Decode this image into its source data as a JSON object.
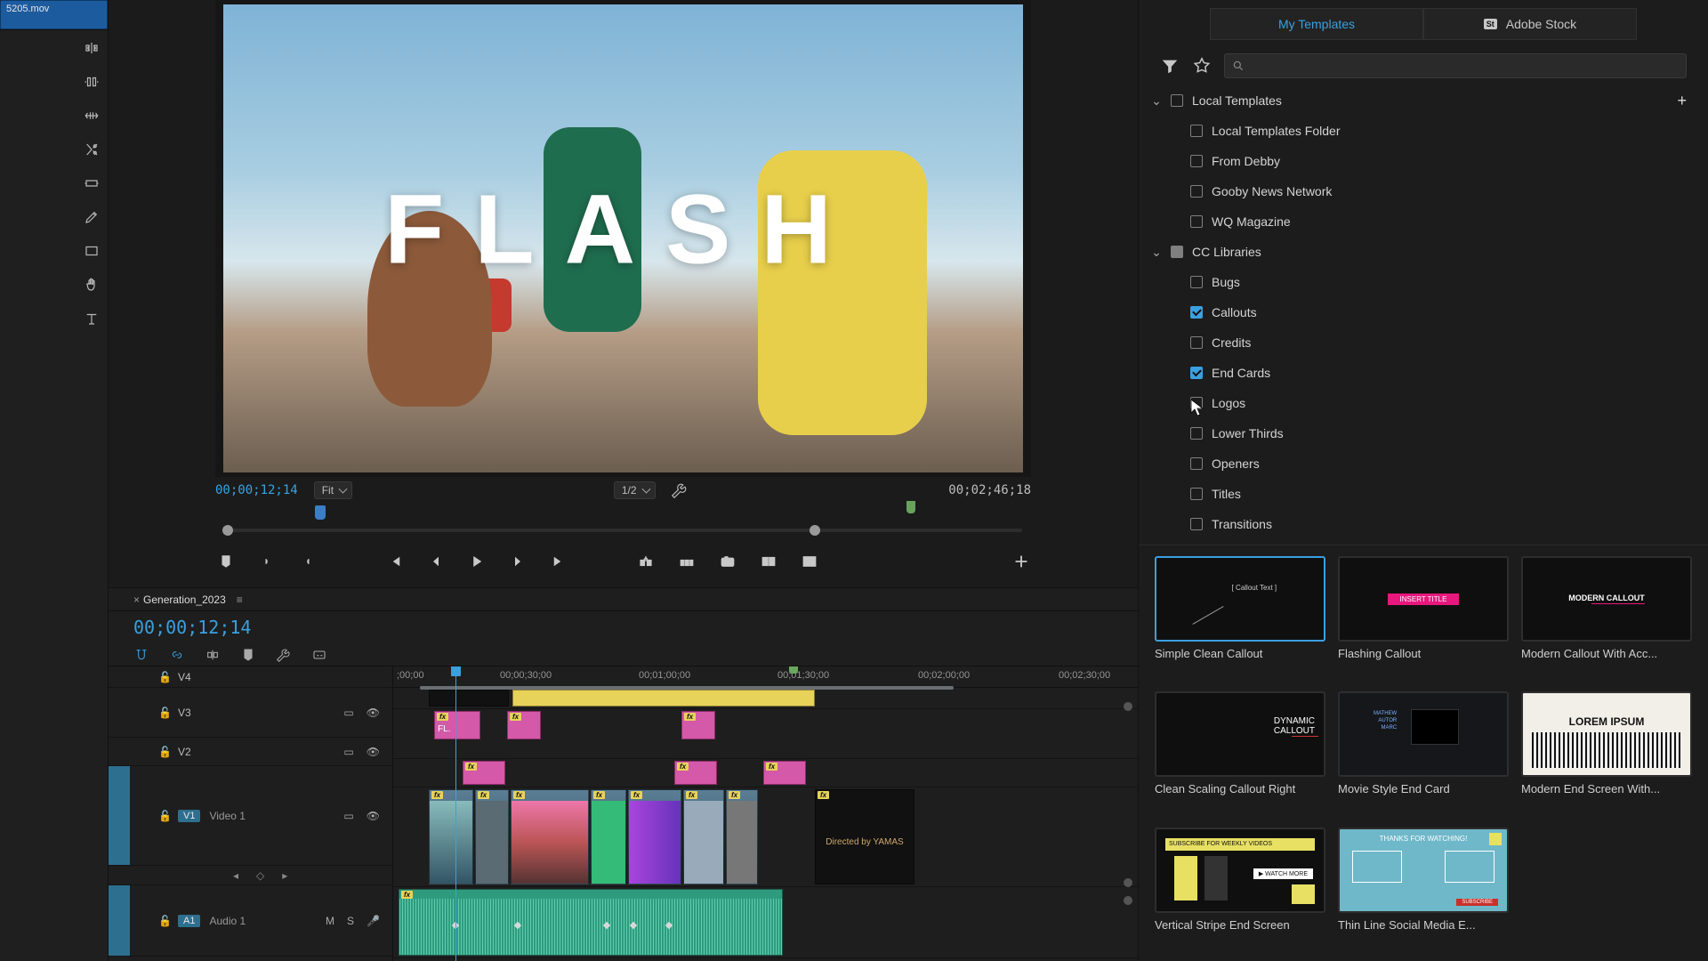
{
  "bin": {
    "clip_name": "5205.mov"
  },
  "monitor": {
    "title_overlay": "FLASH",
    "tc_in": "00;00;12;14",
    "zoom": "Fit",
    "res": "1/2",
    "tc_out": "00;02;46;18"
  },
  "timeline": {
    "sequence_name": "Generation_2023",
    "tc": "00;00;12;14",
    "ruler": [
      ";00;00",
      "00;00;30;00",
      "00;01;00;00",
      "00;01;30;00",
      "00;02;00;00",
      "00;02;30;00"
    ],
    "tracks": {
      "v4": "V4",
      "v3": "V3",
      "v2": "V2",
      "v1": "V1",
      "a1": "A1",
      "video1_label": "Video 1",
      "audio1_label": "Audio 1"
    },
    "audio_toggles": {
      "m": "M",
      "s": "S"
    },
    "v3_clip1": "FL."
  },
  "eg": {
    "tab_my": "My Templates",
    "tab_stock": "Adobe Stock",
    "search_placeholder": "",
    "tree": {
      "local": "Local Templates",
      "local_items": [
        "Local Templates Folder",
        "From Debby",
        "Gooby News Network",
        "WQ Magazine"
      ],
      "cc": "CC Libraries",
      "cc_items": [
        {
          "label": "Bugs",
          "checked": false
        },
        {
          "label": "Callouts",
          "checked": true
        },
        {
          "label": "Credits",
          "checked": false
        },
        {
          "label": "End Cards",
          "checked": true
        },
        {
          "label": "Logos",
          "checked": false
        },
        {
          "label": "Lower Thirds",
          "checked": false
        },
        {
          "label": "Openers",
          "checked": false
        },
        {
          "label": "Titles",
          "checked": false
        },
        {
          "label": "Transitions",
          "checked": false
        }
      ]
    },
    "templates": [
      {
        "name": "Simple Clean Callout"
      },
      {
        "name": "Flashing Callout"
      },
      {
        "name": "Modern Callout With Acc..."
      },
      {
        "name": "Clean Scaling Callout Right"
      },
      {
        "name": "Movie Style End Card"
      },
      {
        "name": "Modern End Screen With..."
      },
      {
        "name": "Vertical Stripe End Screen"
      },
      {
        "name": "Thin Line Social Media E..."
      }
    ],
    "prev_text": {
      "t0": "[ Callout Text ]",
      "t1": "INSERT TITLE",
      "t2": "MODERN CALLOUT",
      "t3": "DYNAMIC\nCALLOUT",
      "t5": "LOREM IPSUM",
      "t6a": "SUBSCRIBE FOR WEEKLY VIDEOS",
      "t6b": "▶ WATCH MORE",
      "t7": "THANKS FOR WATCHING!"
    }
  }
}
